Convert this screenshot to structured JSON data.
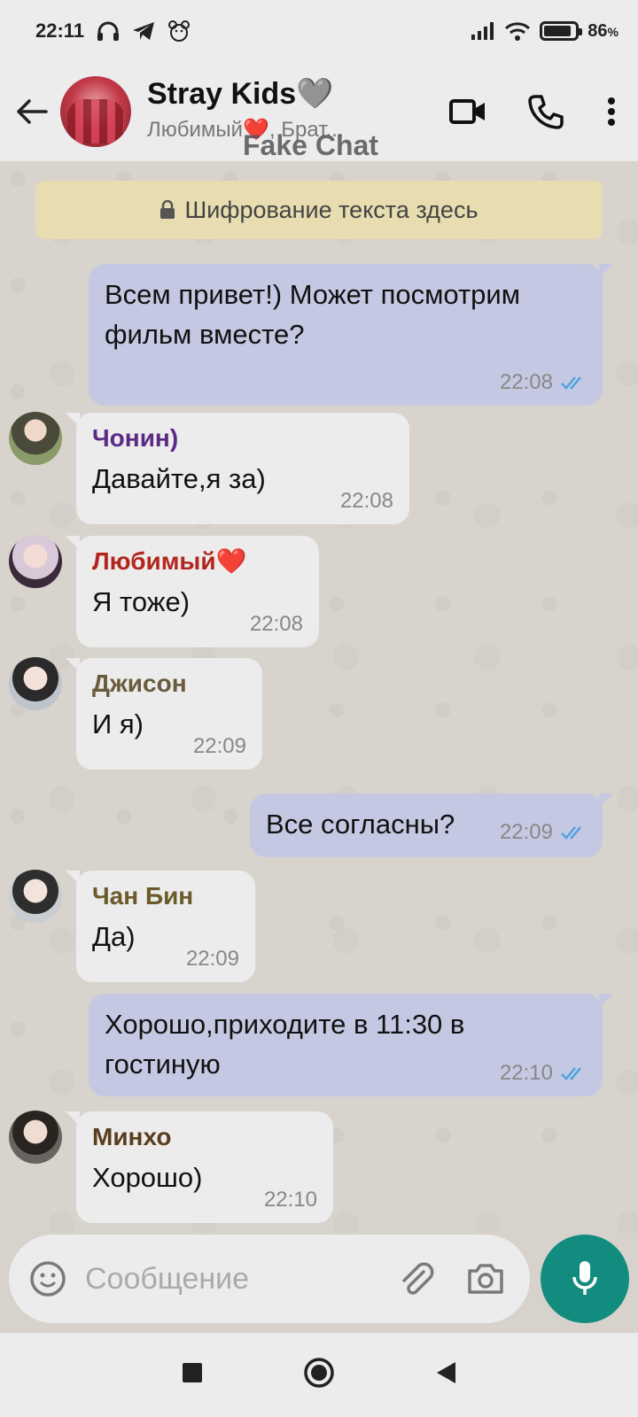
{
  "status_bar": {
    "time": "22:11",
    "icons_left": [
      "headphones-icon",
      "telegram-icon",
      "bear-icon"
    ],
    "icons_right": [
      "signal-icon",
      "wifi-icon",
      "battery-icon"
    ],
    "battery_percent": "86",
    "battery_suffix": "%"
  },
  "header": {
    "title": "Stray Kids",
    "title_emoji": "🩶",
    "subtitle": "Любимый❤️, Брат...",
    "watermark": "Fake Chat"
  },
  "encryption_banner": "Шифрование текста здесь",
  "messages": [
    {
      "direction": "out",
      "text": "Всем привет!) Может посмотрим фильм вместе?",
      "time": "22:08",
      "read": true
    },
    {
      "direction": "in",
      "sender": "Чонин)",
      "sender_color": "#5b2a86",
      "text": "Давайте,я за)",
      "time": "22:08"
    },
    {
      "direction": "in",
      "sender": "Любимый❤️",
      "sender_color": "#b3261e",
      "text": "Я тоже)",
      "time": "22:08"
    },
    {
      "direction": "in",
      "sender": "Джисон",
      "sender_color": "#6b5b3e",
      "text": "И я)",
      "time": "22:09"
    },
    {
      "direction": "out",
      "text": "Все согласны?",
      "time": "22:09",
      "read": true
    },
    {
      "direction": "in",
      "sender": "Чан Бин",
      "sender_color": "#6b5a2a",
      "text": "Да)",
      "time": "22:09"
    },
    {
      "direction": "out",
      "text": "Хорошо,приходите в 11:30 в гостиную",
      "time": "22:10",
      "read": true
    },
    {
      "direction": "in",
      "sender": "Минхо",
      "sender_color": "#5a3d1e",
      "text": "Хорошо)",
      "time": "22:10"
    }
  ],
  "input": {
    "placeholder": "Сообщение"
  },
  "colors": {
    "outgoing_bubble": "#c5c8e2",
    "incoming_bubble": "#ececec",
    "read_ticks": "#4fa3e0",
    "mic_button": "#128c7e",
    "encryption_banner": "#e8ddb0"
  }
}
